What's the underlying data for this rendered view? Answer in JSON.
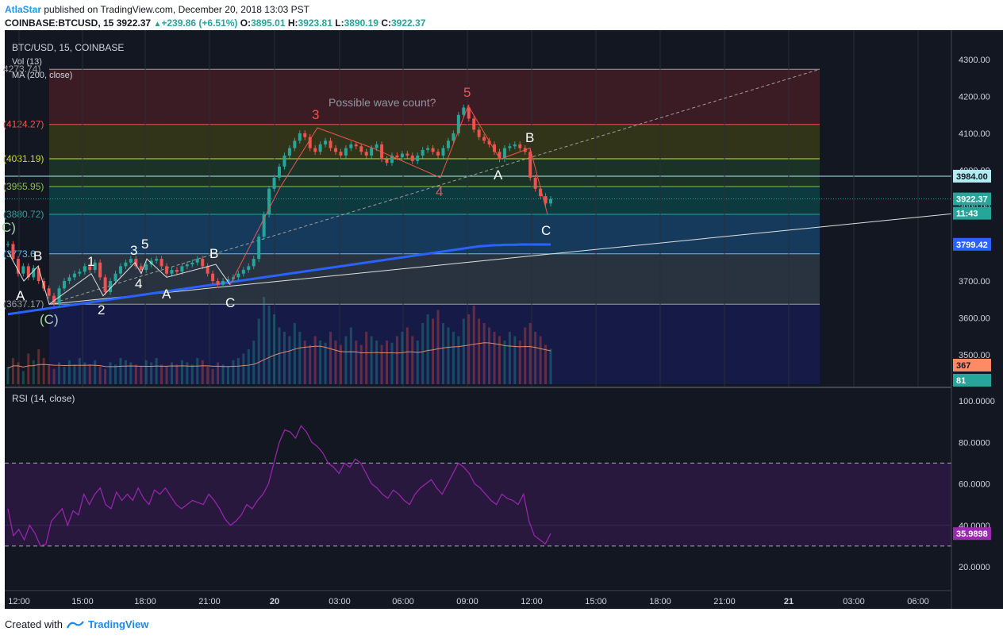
{
  "header": {
    "author": "AtlaStar",
    "published": "published on TradingView.com, December 20, 2018 13:03 PST",
    "symbol": "COINBASE:BTCUSD, 15",
    "last": "3922.37",
    "change": "+239.86 (+6.51%)",
    "o_label": "O:",
    "o": "3895.01",
    "h_label": "H:",
    "h": "3923.81",
    "l_label": "L:",
    "l": "3890.19",
    "c_label": "C:",
    "c": "3922.37"
  },
  "legend": {
    "title": "BTC/USD, 15, COINBASE",
    "vol": "Vol (13)",
    "ma": "MA (200, close)",
    "rsi": "RSI (14, close)"
  },
  "annotations": {
    "note": "Possible wave count?",
    "w3": "3",
    "w4": "4",
    "w5": "5",
    "A1": "A",
    "B1": "B",
    "C1": "(C)",
    "one": "1",
    "two": "2",
    "three": "3",
    "four": "4",
    "five": "5",
    "A2": "A",
    "B2": "B",
    "C2": "C",
    "A3": "A",
    "B3": "B",
    "C3": "C",
    "edgeC": "C)"
  },
  "fib_labels": [
    "4273.74)",
    "(4124.27)",
    "(4031.19)",
    "(3955.95)",
    "(3880.72)",
    "(3773.6",
    "(3637.17)"
  ],
  "price_tags": {
    "hline": "3984.00",
    "last": "3922.37",
    "countdown": "11:43",
    "ma": "3799.42",
    "vol_ma": "367",
    "vol": "81",
    "rsi": "35.9898"
  },
  "footer": {
    "created": "Created with",
    "brand": "TradingView"
  },
  "colors": {
    "up": "#26a69a",
    "down": "#ef5350",
    "ma": "#2962ff",
    "rsi": "#9c27b0",
    "fib_top": "#a52a2a",
    "fib_mid": "#808000",
    "fib_green": "#2e7d32",
    "fib_teal": "#009688",
    "fib_blue": "#2196f3",
    "fib_navy": "#1a237e"
  },
  "chart_data": {
    "type": "candlestick",
    "title": "BTC/USD, 15, COINBASE",
    "x_ticks": [
      "12:00",
      "15:00",
      "18:00",
      "21:00",
      "20",
      "03:00",
      "06:00",
      "09:00",
      "12:00",
      "15:00",
      "18:00",
      "21:00",
      "21",
      "03:00",
      "06:00"
    ],
    "y_ticks": [
      "4300.00",
      "4200.00",
      "4100.00",
      "4000.00",
      "3900.00",
      "3800.00",
      "3700.00",
      "3600.00",
      "3500.00"
    ],
    "ylim": [
      3420,
      4330
    ],
    "rsi_ticks": [
      "100.0000",
      "80.0000",
      "60.0000",
      "40.0000",
      "20.0000"
    ],
    "rsi_lim": [
      0,
      105
    ],
    "rsi_bands": [
      70,
      30
    ],
    "fib_levels": [
      4273.74,
      4124.27,
      4031.19,
      3955.95,
      3880.72,
      3773.6,
      3637.17
    ],
    "close": [
      3800,
      3760,
      3720,
      3740,
      3710,
      3735,
      3700,
      3680,
      3660,
      3640,
      3680,
      3700,
      3710,
      3720,
      3725,
      3740,
      3730,
      3750,
      3710,
      3670,
      3700,
      3720,
      3740,
      3750,
      3760,
      3740,
      3730,
      3745,
      3755,
      3760,
      3740,
      3720,
      3730,
      3725,
      3740,
      3745,
      3750,
      3760,
      3740,
      3720,
      3700,
      3690,
      3700,
      3705,
      3710,
      3720,
      3730,
      3740,
      3760,
      3820,
      3880,
      3950,
      3980,
      4010,
      4040,
      4060,
      4080,
      4100,
      4090,
      4060,
      4050,
      4070,
      4080,
      4060,
      4050,
      4040,
      4060,
      4070,
      4065,
      4050,
      4040,
      4060,
      4070,
      4030,
      4020,
      4040,
      4035,
      4045,
      4040,
      4025,
      4040,
      4055,
      4060,
      4050,
      4040,
      4060,
      4080,
      4100,
      4150,
      4170,
      4140,
      4110,
      4090,
      4080,
      4070,
      4050,
      4030,
      4060,
      4065,
      4070,
      4060,
      4050,
      3980,
      3950,
      3930,
      3910,
      3922
    ],
    "ma200": [
      3610,
      3612,
      3614,
      3616,
      3618,
      3620,
      3622,
      3624,
      3626,
      3628,
      3630,
      3632,
      3634,
      3636,
      3638,
      3640,
      3642,
      3644,
      3646,
      3648,
      3650,
      3652,
      3654,
      3656,
      3658,
      3660,
      3662,
      3664,
      3666,
      3668,
      3670,
      3672,
      3674,
      3676,
      3678,
      3680,
      3682,
      3684,
      3686,
      3688,
      3690,
      3692,
      3694,
      3696,
      3698,
      3700,
      3702,
      3704,
      3706,
      3708,
      3710,
      3712,
      3714,
      3716,
      3718,
      3720,
      3722,
      3724,
      3726,
      3728,
      3730,
      3732,
      3734,
      3736,
      3738,
      3740,
      3742,
      3744,
      3746,
      3748,
      3750,
      3752,
      3754,
      3756,
      3758,
      3760,
      3762,
      3764,
      3766,
      3768,
      3770,
      3772,
      3774,
      3776,
      3778,
      3780,
      3782,
      3784,
      3786,
      3788,
      3790,
      3792,
      3794,
      3795,
      3796,
      3797,
      3797,
      3798,
      3798,
      3798,
      3799,
      3799,
      3799,
      3799,
      3799,
      3799,
      3799
    ],
    "volume": [
      40,
      60,
      50,
      30,
      70,
      55,
      80,
      60,
      45,
      35,
      50,
      40,
      55,
      45,
      60,
      50,
      45,
      55,
      40,
      35,
      50,
      45,
      60,
      55,
      50,
      45,
      40,
      55,
      50,
      60,
      45,
      40,
      50,
      45,
      55,
      50,
      45,
      60,
      55,
      40,
      35,
      50,
      45,
      40,
      55,
      60,
      70,
      80,
      100,
      150,
      200,
      180,
      160,
      130,
      120,
      110,
      140,
      120,
      100,
      90,
      110,
      100,
      95,
      120,
      100,
      90,
      110,
      130,
      100,
      90,
      120,
      110,
      100,
      90,
      100,
      95,
      110,
      120,
      130,
      110,
      100,
      140,
      160,
      150,
      170,
      140,
      130,
      120,
      110,
      150,
      160,
      180,
      150,
      140,
      130,
      120,
      110,
      100,
      120,
      110,
      100,
      130,
      140,
      120,
      110,
      90,
      81
    ],
    "rsi": [
      48,
      35,
      38,
      33,
      40,
      36,
      30,
      31,
      42,
      45,
      48,
      40,
      47,
      45,
      55,
      50,
      55,
      58,
      50,
      48,
      56,
      52,
      55,
      52,
      58,
      53,
      50,
      57,
      55,
      58,
      54,
      50,
      48,
      50,
      52,
      51,
      50,
      55,
      52,
      48,
      43,
      40,
      42,
      45,
      50,
      48,
      52,
      55,
      60,
      70,
      80,
      86,
      85,
      82,
      88,
      85,
      80,
      78,
      75,
      70,
      68,
      65,
      70,
      68,
      72,
      70,
      65,
      60,
      58,
      55,
      53,
      57,
      55,
      52,
      50,
      55,
      58,
      60,
      62,
      58,
      55,
      60,
      65,
      70,
      68,
      65,
      60,
      58,
      55,
      52,
      50,
      55,
      53,
      52,
      50,
      55,
      42,
      35,
      33,
      31,
      36
    ]
  }
}
